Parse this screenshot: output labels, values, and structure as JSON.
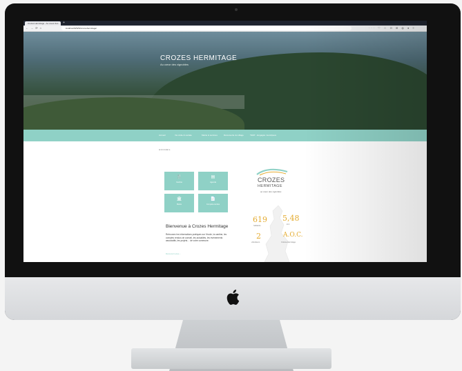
{
  "browser": {
    "tab_title": "Crozes Hermitage - Au coeur des...",
    "new_tab": "+",
    "nav_icons": "← → ⟳ ⌂",
    "url": "localhost/WWW/crozeshermitage/",
    "right_icons": "··· ♡ ☆  ⊡ ⊞ ◍ ● ≡"
  },
  "site": {
    "title": "CROZES HERMITAGE",
    "tagline": "Au cœur des vignobles"
  },
  "menu": [
    "Accueil",
    "Vie civile & sociale",
    "Mairie & services",
    "Découverte du village",
    "TEST - Engagés municipaux"
  ],
  "breadcrumb": "ACCUEIL",
  "tiles": [
    {
      "label": "Cantine",
      "icon": "🍴"
    },
    {
      "label": "Agenda",
      "icon": "▤"
    },
    {
      "label": "Mairie",
      "icon": "🏛"
    },
    {
      "label": "Comptes-rendus",
      "icon": "📄"
    }
  ],
  "welcome": {
    "title": "Bienvenue à Crozes Hermitage",
    "text": "Retrouvez les informations pratiques sur l'école, la cantine, les comptes rendus de conseil, les actualités, les évènements associatifs, les projets… de votre commune.",
    "more": "Découvrir plus ›"
  },
  "logo": {
    "line1": "CROZES",
    "line2": "HERMITAGE",
    "sub": "au cœur des vignobles"
  },
  "stats": [
    {
      "value": "619",
      "label": "habitants"
    },
    {
      "value": "5,48",
      "label": "km²"
    },
    {
      "value": "2",
      "label": "viticulteurs"
    },
    {
      "value": "A.O.C.",
      "label": "Crozes-Hermitage"
    }
  ],
  "colors": {
    "accent": "#8fd1c6",
    "stat_gold": "#e4ab2f",
    "hero_dark": "#2b4730"
  },
  "icons": {
    "hardware_logo": "apple-logo-icon"
  }
}
